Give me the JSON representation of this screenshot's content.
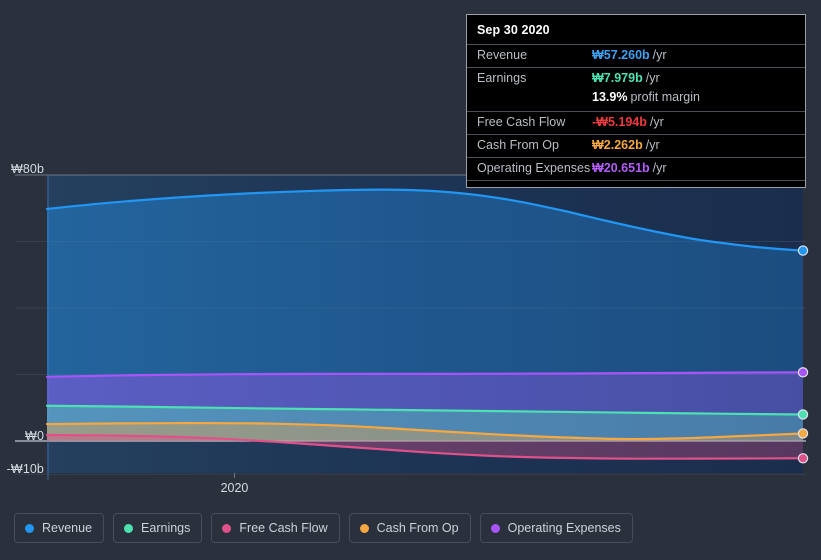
{
  "chart_data": {
    "type": "area",
    "title": "",
    "xlabel": "",
    "ylabel": "",
    "currency_symbol": "₩",
    "unit": "b",
    "ylim": [
      -10,
      80
    ],
    "y_ticks": [
      {
        "value": 80,
        "label": "₩80b"
      },
      {
        "value": 0,
        "label": "₩0"
      },
      {
        "value": -10,
        "label": "-₩10b"
      }
    ],
    "gridlines": [
      80,
      60,
      40,
      20,
      0,
      -10
    ],
    "x_ticks": [
      {
        "label": "2020",
        "position": 0.248
      }
    ],
    "grid": true,
    "legend_position": "bottom",
    "hovered_point": "Sep 30 2020",
    "series": [
      {
        "name": "Revenue",
        "color": "#2196f3",
        "end_value": 57.26,
        "points": [
          [
            0.0,
            69.8
          ],
          [
            0.08,
            71.6
          ],
          [
            0.17,
            73.2
          ],
          [
            0.26,
            74.4
          ],
          [
            0.35,
            75.2
          ],
          [
            0.44,
            75.6
          ],
          [
            0.5,
            75.3
          ],
          [
            0.56,
            74.2
          ],
          [
            0.62,
            72.2
          ],
          [
            0.68,
            69.4
          ],
          [
            0.74,
            66.2
          ],
          [
            0.8,
            63.2
          ],
          [
            0.86,
            60.6
          ],
          [
            0.92,
            58.8
          ],
          [
            0.96,
            57.9
          ],
          [
            1.0,
            57.26
          ]
        ]
      },
      {
        "name": "Operating Expenses",
        "color": "#a855f7",
        "end_value": 20.651,
        "points": [
          [
            0.0,
            19.3
          ],
          [
            0.12,
            19.8
          ],
          [
            0.25,
            20.1
          ],
          [
            0.4,
            20.2
          ],
          [
            0.55,
            20.2
          ],
          [
            0.7,
            20.3
          ],
          [
            0.85,
            20.5
          ],
          [
            1.0,
            20.651
          ]
        ]
      },
      {
        "name": "Earnings",
        "color": "#4ce0b3",
        "end_value": 7.979,
        "points": [
          [
            0.0,
            10.6
          ],
          [
            0.12,
            10.3
          ],
          [
            0.25,
            9.9
          ],
          [
            0.4,
            9.5
          ],
          [
            0.55,
            9.1
          ],
          [
            0.7,
            8.7
          ],
          [
            0.85,
            8.3
          ],
          [
            1.0,
            7.979
          ]
        ]
      },
      {
        "name": "Cash From Op",
        "color": "#f5a742",
        "end_value": 2.262,
        "points": [
          [
            0.0,
            5.1
          ],
          [
            0.1,
            5.3
          ],
          [
            0.2,
            5.4
          ],
          [
            0.3,
            5.2
          ],
          [
            0.4,
            4.5
          ],
          [
            0.5,
            3.2
          ],
          [
            0.6,
            1.9
          ],
          [
            0.68,
            1.1
          ],
          [
            0.76,
            0.6
          ],
          [
            0.84,
            0.8
          ],
          [
            0.92,
            1.5
          ],
          [
            1.0,
            2.262
          ]
        ]
      },
      {
        "name": "Free Cash Flow",
        "color": "#e0518a",
        "end_value": -5.194,
        "points": [
          [
            0.0,
            1.8
          ],
          [
            0.1,
            1.6
          ],
          [
            0.2,
            1.0
          ],
          [
            0.3,
            -0.2
          ],
          [
            0.4,
            -1.8
          ],
          [
            0.5,
            -3.4
          ],
          [
            0.58,
            -4.4
          ],
          [
            0.66,
            -5.0
          ],
          [
            0.76,
            -5.3
          ],
          [
            0.86,
            -5.3
          ],
          [
            1.0,
            -5.194
          ]
        ]
      }
    ]
  },
  "tooltip": {
    "date": "Sep 30 2020",
    "rows": [
      {
        "key": "Revenue",
        "value": "₩57.260b",
        "suffix": "/yr",
        "color": "#3ea0f0"
      },
      {
        "key": "Earnings",
        "value": "₩7.979b",
        "suffix": "/yr",
        "color": "#4ce0b3"
      },
      {
        "key": "",
        "value": "13.9%",
        "suffix": "profit margin",
        "color": "#ffffff",
        "sub": true
      },
      {
        "key": "Free Cash Flow",
        "value": "-₩5.194b",
        "suffix": "/yr",
        "color": "#ef3b3b"
      },
      {
        "key": "Cash From Op",
        "value": "₩2.262b",
        "suffix": "/yr",
        "color": "#f5a742"
      },
      {
        "key": "Operating Expenses",
        "value": "₩20.651b",
        "suffix": "/yr",
        "color": "#b45cf7"
      }
    ]
  },
  "legend": {
    "items": [
      {
        "label": "Revenue",
        "color": "#2196f3"
      },
      {
        "label": "Earnings",
        "color": "#4ce0b3"
      },
      {
        "label": "Free Cash Flow",
        "color": "#e0518a"
      },
      {
        "label": "Cash From Op",
        "color": "#f5a742"
      },
      {
        "label": "Operating Expenses",
        "color": "#a855f7"
      }
    ]
  },
  "axis_labels": {
    "y_top": "₩80b",
    "y_zero": "₩0",
    "y_bottom": "-₩10b",
    "x_2020": "2020"
  }
}
